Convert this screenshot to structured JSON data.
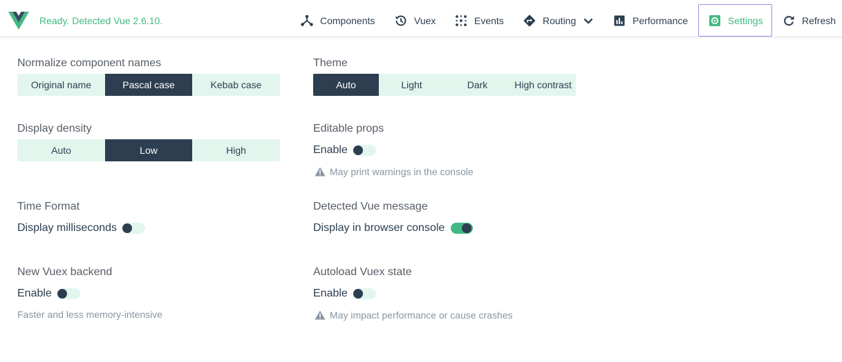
{
  "header": {
    "status": "Ready. Detected Vue 2.6.10.",
    "nav": [
      {
        "label": "Components",
        "icon": "component-tree-icon"
      },
      {
        "label": "Vuex",
        "icon": "history-icon"
      },
      {
        "label": "Events",
        "icon": "events-icon"
      },
      {
        "label": "Routing",
        "icon": "routing-icon"
      },
      {
        "label": "Performance",
        "icon": "bar-chart-icon"
      },
      {
        "label": "Settings",
        "icon": "settings-icon"
      },
      {
        "label": "Refresh",
        "icon": "refresh-icon"
      }
    ],
    "active_tab": "Settings"
  },
  "settings": {
    "component_names": {
      "title": "Normalize component names",
      "options": [
        "Original name",
        "Pascal case",
        "Kebab case"
      ],
      "selected": "Pascal case"
    },
    "theme": {
      "title": "Theme",
      "options": [
        "Auto",
        "Light",
        "Dark",
        "High contrast"
      ],
      "selected": "Auto"
    },
    "density": {
      "title": "Display density",
      "options": [
        "Auto",
        "Low",
        "High"
      ],
      "selected": "Low"
    },
    "editable_props": {
      "title": "Editable props",
      "toggle_label": "Enable",
      "enabled": false,
      "hint": "May print warnings in the console"
    },
    "time_format": {
      "title": "Time Format",
      "toggle_label": "Display milliseconds",
      "enabled": false
    },
    "detected_vue": {
      "title": "Detected Vue message",
      "toggle_label": "Display in browser console",
      "enabled": true
    },
    "vuex_backend": {
      "title": "New Vuex backend",
      "toggle_label": "Enable",
      "enabled": false,
      "hint": "Faster and less memory-intensive"
    },
    "autoload_vuex": {
      "title": "Autoload Vuex state",
      "toggle_label": "Enable",
      "enabled": false,
      "hint": "May impact performance or cause crashes"
    }
  },
  "colors": {
    "brand_green": "#42b983",
    "dark": "#2c3e50",
    "segment_bg": "#e3f6ee",
    "active_border": "#a987e8"
  }
}
